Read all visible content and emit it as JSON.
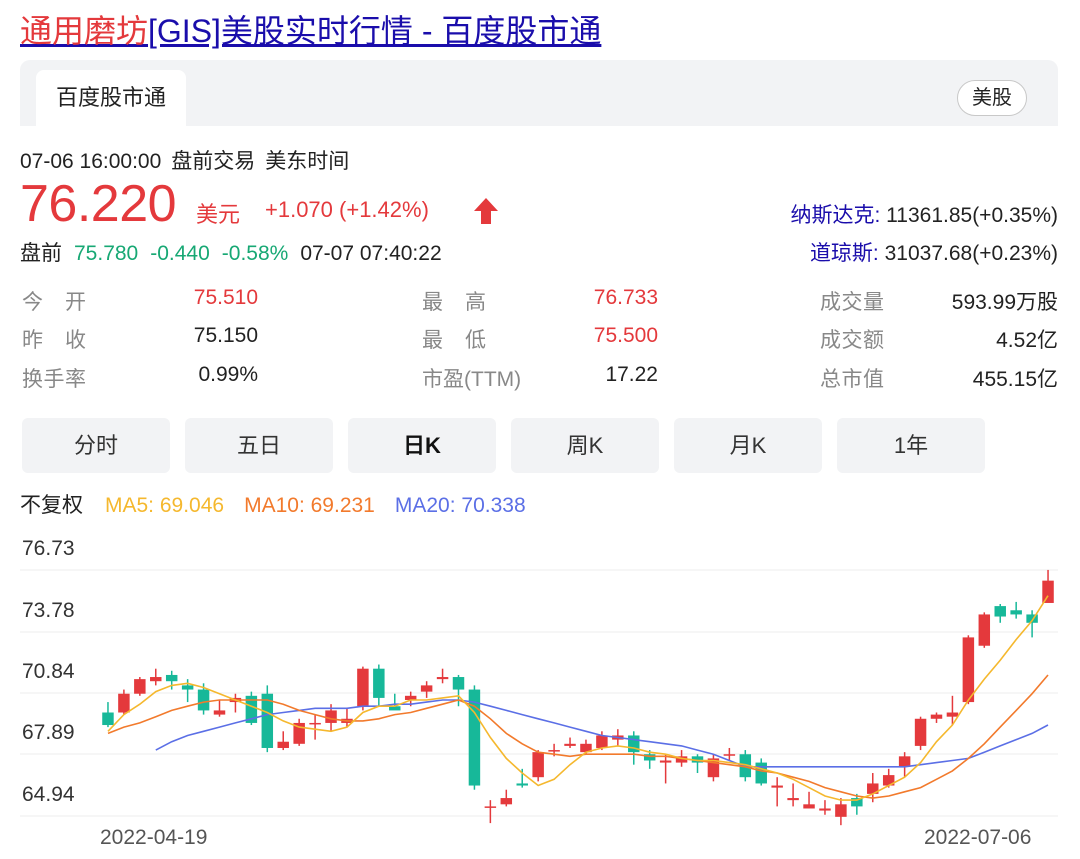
{
  "page_title": {
    "highlight": "通用磨坊",
    "rest": "[GIS]美股实时行情 - 百度股市通"
  },
  "tabs": {
    "source_tab": "百度股市通",
    "market_badge": "美股"
  },
  "meta": {
    "datetime": "07-06 16:00:00",
    "session": "盘前交易",
    "timezone": "美东时间"
  },
  "quote": {
    "price": "76.220",
    "currency": "美元",
    "change": "+1.070 (+1.42%)"
  },
  "premarket": {
    "label": "盘前",
    "price": "75.780",
    "change": "-0.440",
    "pct": "-0.58%",
    "time": "07-07 07:40:22"
  },
  "indices": [
    {
      "name": "纳斯达克:",
      "value": " 11361.85(+0.35%)"
    },
    {
      "name": "道琼斯:",
      "value": " 31037.68(+0.23%)"
    }
  ],
  "stats": {
    "open_label": "今　开",
    "open": "75.510",
    "prev_label": "昨　收",
    "prev": "75.150",
    "turnover_label": "换手率",
    "turnover": "0.99%",
    "high_label": "最　高",
    "high": "76.733",
    "low_label": "最　低",
    "low": "75.500",
    "pe_label": "市盈(TTM)",
    "pe": "17.22",
    "vol_label": "成交量",
    "vol": "593.99万股",
    "amt_label": "成交额",
    "amt": "4.52亿",
    "cap_label": "总市值",
    "cap": "455.15亿"
  },
  "period_tabs": [
    "分时",
    "五日",
    "日K",
    "周K",
    "月K",
    "1年"
  ],
  "ma": {
    "adjust": "不复权",
    "ma5": "MA5: 69.046",
    "ma10": "MA10: 69.231",
    "ma20": "MA20: 70.338"
  },
  "colors": {
    "up": "#e4393c",
    "down": "#17b899",
    "ma5": "#f5b82e",
    "ma10": "#f27a2c",
    "ma20": "#5b6fe6",
    "link": "#1a0dab"
  },
  "chart_data": {
    "type": "candlestick",
    "ylim": [
      64.94,
      76.73
    ],
    "yticks": [
      "76.73",
      "73.78",
      "70.84",
      "67.89",
      "64.94"
    ],
    "x_start_label": "2022-04-19",
    "x_end_label": "2022-07-06",
    "candles": [
      [
        69.9,
        69.3,
        70.4,
        69.2
      ],
      [
        69.9,
        70.8,
        71.0,
        69.8
      ],
      [
        70.8,
        71.5,
        71.6,
        70.7
      ],
      [
        71.4,
        71.6,
        72.0,
        71.2
      ],
      [
        71.7,
        71.4,
        71.9,
        71.0
      ],
      [
        71.2,
        71.0,
        71.5,
        70.4
      ],
      [
        71.0,
        70.0,
        71.3,
        69.8
      ],
      [
        69.8,
        70.0,
        70.5,
        69.7
      ],
      [
        70.4,
        70.6,
        70.8,
        69.9
      ],
      [
        70.7,
        69.4,
        70.9,
        69.3
      ],
      [
        70.8,
        68.2,
        71.2,
        68.0
      ],
      [
        68.2,
        68.5,
        69.0,
        68.1
      ],
      [
        68.4,
        69.4,
        69.6,
        68.3
      ],
      [
        69.4,
        69.4,
        69.8,
        68.6
      ],
      [
        69.4,
        70.0,
        70.3,
        69.0
      ],
      [
        69.4,
        69.6,
        70.1,
        69.2
      ],
      [
        70.2,
        72.0,
        72.1,
        70.0
      ],
      [
        72.0,
        70.6,
        72.2,
        70.2
      ],
      [
        70.2,
        70.0,
        70.8,
        70.1
      ],
      [
        70.5,
        70.7,
        70.9,
        70.2
      ],
      [
        70.9,
        71.2,
        71.4,
        70.6
      ],
      [
        71.5,
        71.6,
        72.0,
        71.3
      ],
      [
        71.6,
        71.0,
        71.7,
        70.2
      ],
      [
        71.0,
        66.4,
        71.2,
        66.2
      ],
      [
        65.4,
        65.4,
        65.7,
        64.6
      ],
      [
        65.5,
        65.8,
        66.2,
        65.4
      ],
      [
        66.5,
        66.4,
        67.2,
        66.3
      ],
      [
        66.8,
        68.0,
        68.1,
        66.6
      ],
      [
        68.1,
        68.1,
        68.4,
        67.8
      ],
      [
        68.3,
        68.4,
        68.7,
        68.2
      ],
      [
        68.0,
        68.4,
        68.6,
        67.9
      ],
      [
        68.2,
        68.8,
        69.0,
        68.1
      ],
      [
        68.6,
        68.8,
        69.1,
        68.3
      ],
      [
        68.8,
        68.0,
        69.0,
        67.4
      ],
      [
        67.9,
        67.6,
        68.1,
        67.2
      ],
      [
        67.5,
        67.6,
        67.9,
        66.5
      ],
      [
        67.5,
        67.8,
        68.1,
        67.3
      ],
      [
        67.8,
        67.5,
        67.9,
        67.0
      ],
      [
        66.8,
        67.7,
        67.9,
        66.6
      ],
      [
        67.9,
        67.9,
        68.2,
        67.6
      ],
      [
        67.9,
        66.8,
        68.1,
        66.6
      ],
      [
        67.5,
        66.5,
        67.7,
        66.4
      ],
      [
        66.3,
        66.4,
        66.8,
        65.4
      ],
      [
        65.7,
        65.8,
        66.5,
        65.4
      ],
      [
        65.3,
        65.5,
        66.1,
        65.3
      ],
      [
        65.2,
        65.3,
        65.7,
        65.0
      ],
      [
        64.9,
        65.5,
        65.8,
        64.5
      ],
      [
        65.8,
        65.4,
        66.0,
        65.0
      ],
      [
        66.0,
        66.5,
        67.0,
        65.6
      ],
      [
        66.4,
        66.9,
        67.2,
        66.3
      ],
      [
        67.3,
        67.8,
        68.0,
        66.8
      ],
      [
        68.3,
        69.6,
        69.7,
        68.1
      ],
      [
        69.6,
        69.8,
        69.9,
        69.4
      ],
      [
        69.7,
        69.9,
        70.7,
        69.3
      ],
      [
        70.4,
        73.5,
        73.6,
        70.3
      ],
      [
        73.1,
        74.6,
        74.7,
        73.0
      ],
      [
        75.0,
        74.5,
        75.1,
        74.2
      ],
      [
        74.8,
        74.6,
        75.2,
        74.4
      ],
      [
        74.6,
        74.2,
        74.8,
        73.5
      ],
      [
        75.15,
        76.22,
        76.733,
        75.5
      ]
    ],
    "ma5": [
      69.0,
      69.8,
      70.3,
      70.9,
      71.2,
      71.3,
      71.1,
      70.8,
      70.5,
      70.2,
      69.9,
      69.5,
      69.2,
      69.1,
      69.0,
      69.2,
      69.9,
      70.2,
      70.2,
      70.5,
      70.5,
      70.6,
      70.7,
      69.9,
      68.7,
      67.7,
      67.0,
      66.4,
      66.7,
      67.4,
      68.0,
      68.2,
      68.3,
      68.2,
      68.0,
      67.9,
      67.7,
      67.6,
      67.6,
      67.5,
      67.4,
      67.2,
      67.0,
      66.7,
      66.3,
      65.9,
      65.7,
      65.7,
      66.0,
      66.4,
      66.8,
      67.5,
      68.5,
      69.3,
      70.5,
      71.5,
      72.4,
      73.4,
      74.3,
      75.5
    ],
    "ma10": [
      68.9,
      69.2,
      69.4,
      69.7,
      70.0,
      70.2,
      70.4,
      70.5,
      70.5,
      70.5,
      70.5,
      70.3,
      70.0,
      69.8,
      69.6,
      69.5,
      69.5,
      69.6,
      69.8,
      69.9,
      70.1,
      70.3,
      70.5,
      70.2,
      69.6,
      68.9,
      68.4,
      68.0,
      67.9,
      67.8,
      67.9,
      67.9,
      67.9,
      67.9,
      67.8,
      67.8,
      67.7,
      67.6,
      67.5,
      67.4,
      67.3,
      67.1,
      67.0,
      66.8,
      66.6,
      66.3,
      66.1,
      65.9,
      65.8,
      65.9,
      66.1,
      66.3,
      66.7,
      67.1,
      67.7,
      68.4,
      69.2,
      70.0,
      70.8,
      71.7
    ],
    "ma20": [
      null,
      null,
      null,
      68.1,
      68.5,
      68.8,
      69.0,
      69.2,
      69.4,
      69.6,
      69.8,
      69.9,
      70.0,
      70.1,
      70.1,
      70.1,
      70.2,
      70.2,
      70.3,
      70.3,
      70.4,
      70.5,
      70.5,
      70.4,
      70.2,
      70.0,
      69.8,
      69.6,
      69.4,
      69.2,
      69.0,
      68.8,
      68.7,
      68.6,
      68.5,
      68.4,
      68.3,
      68.1,
      67.9,
      67.6,
      67.3,
      67.3,
      67.3,
      67.3,
      67.3,
      67.3,
      67.3,
      67.3,
      67.3,
      67.3,
      67.3,
      67.4,
      67.5,
      67.6,
      67.7,
      68.0,
      68.3,
      68.6,
      68.9,
      69.3
    ]
  }
}
